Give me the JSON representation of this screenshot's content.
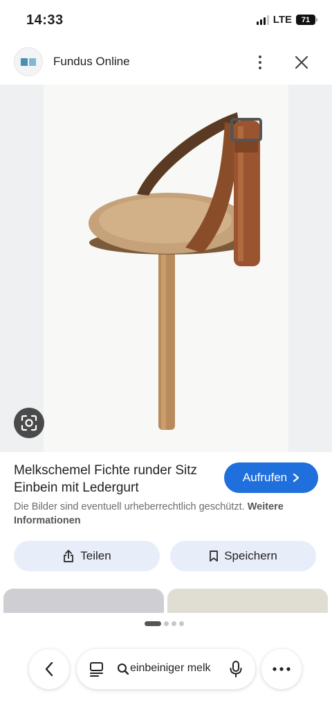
{
  "status_bar": {
    "time": "14:33",
    "network": "LTE",
    "battery": "71"
  },
  "header": {
    "site_name": "Fundus Online",
    "logo_icon": "fundus-logo",
    "more_icon": "more-vert-icon",
    "close_icon": "close-icon"
  },
  "image": {
    "description_icon": "stool-with-leather-strap-photo",
    "lens_icon": "lens-icon"
  },
  "result": {
    "title": "Melkschemel Fichte runder Sitz Einbein mit Ledergurt",
    "call_label": "Aufrufen",
    "notice_text": "Die Bilder sind eventuell urheberrechtlich geschützt.",
    "notice_link": "Weitere Informationen"
  },
  "actions": {
    "share_label": "Teilen",
    "save_label": "Speichern"
  },
  "pager": {
    "active_index": 0,
    "count": 4
  },
  "bottom_bar": {
    "search_query": "einbeiniger melk",
    "back_icon": "back-icon",
    "menu_icon": "more-horiz-icon"
  },
  "colors": {
    "accent": "#1f6fdc",
    "chip_bg": "#e8eef9",
    "image_bg": "#eef0f2"
  }
}
